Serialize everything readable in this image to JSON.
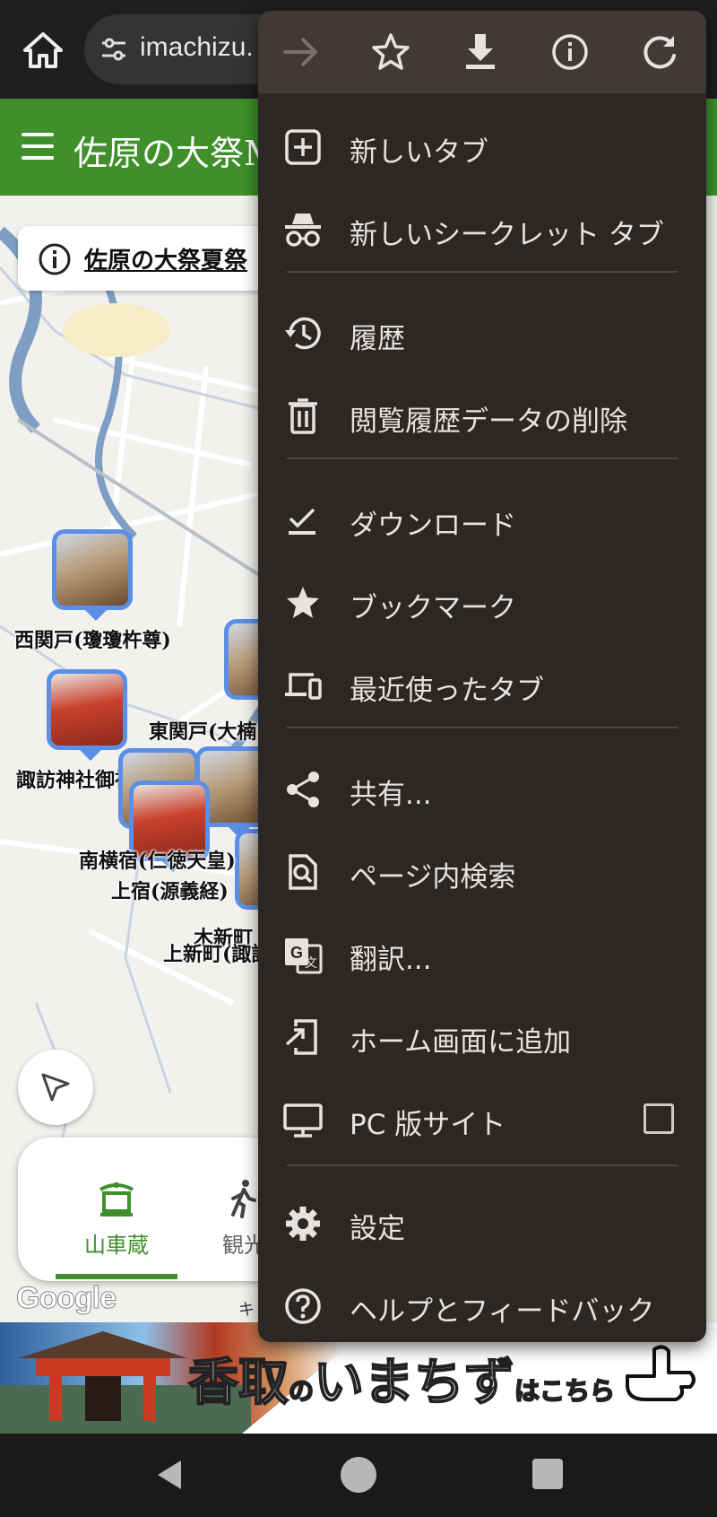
{
  "browser": {
    "url": "imachizu.",
    "home_icon": "home-icon",
    "site_settings_icon": "tune-icon"
  },
  "app": {
    "title": "佐原の大祭M"
  },
  "map": {
    "notice_text": "佐原の大祭夏祭",
    "markers": [
      {
        "label": "西関戸(瓊瓊杵尊)"
      },
      {
        "label": "東関戸(大楠"
      },
      {
        "label": "諏訪神社御神輿"
      },
      {
        "label": "南横宿(仁徳天皇)"
      },
      {
        "label": "上宿(源義経)"
      },
      {
        "label": "上新町(諏訪"
      },
      {
        "label": "木新町"
      }
    ],
    "attribution": "キ",
    "google": "Google"
  },
  "bottom_tabs": [
    {
      "label": "山車蔵",
      "icon": "shrine-icon",
      "active": true
    },
    {
      "label": "観光",
      "icon": "walking-icon",
      "active": false
    }
  ],
  "banner": {
    "text_main": "香取",
    "text_no": "の",
    "text_imachizu": "いまちず",
    "text_sub": "はこちら"
  },
  "menu": {
    "toolbar": [
      "forward-icon",
      "bookmark-star-icon",
      "download-icon",
      "info-icon",
      "reload-icon"
    ],
    "items": [
      {
        "label": "新しいタブ",
        "icon": "new-tab-icon"
      },
      {
        "label": "新しいシークレット タブ",
        "icon": "incognito-icon"
      },
      {
        "label": "履歴",
        "icon": "history-icon"
      },
      {
        "label": "閲覧履歴データの削除",
        "icon": "trash-icon"
      },
      {
        "label": "ダウンロード",
        "icon": "downloads-icon"
      },
      {
        "label": "ブックマーク",
        "icon": "bookmarks-icon"
      },
      {
        "label": "最近使ったタブ",
        "icon": "recent-tabs-icon"
      },
      {
        "label": "共有...",
        "icon": "share-icon"
      },
      {
        "label": "ページ内検索",
        "icon": "find-in-page-icon"
      },
      {
        "label": "翻訳...",
        "icon": "translate-icon"
      },
      {
        "label": "ホーム画面に追加",
        "icon": "add-to-home-icon"
      },
      {
        "label": "PC 版サイト",
        "icon": "desktop-icon",
        "checked": false
      },
      {
        "label": "設定",
        "icon": "settings-gear-icon"
      },
      {
        "label": "ヘルプとフィードバック",
        "icon": "help-icon"
      }
    ]
  },
  "colors": {
    "header_green": "#3f8f2a",
    "menu_bg": "#2c2725",
    "marker_blue": "#5b8fe6"
  }
}
